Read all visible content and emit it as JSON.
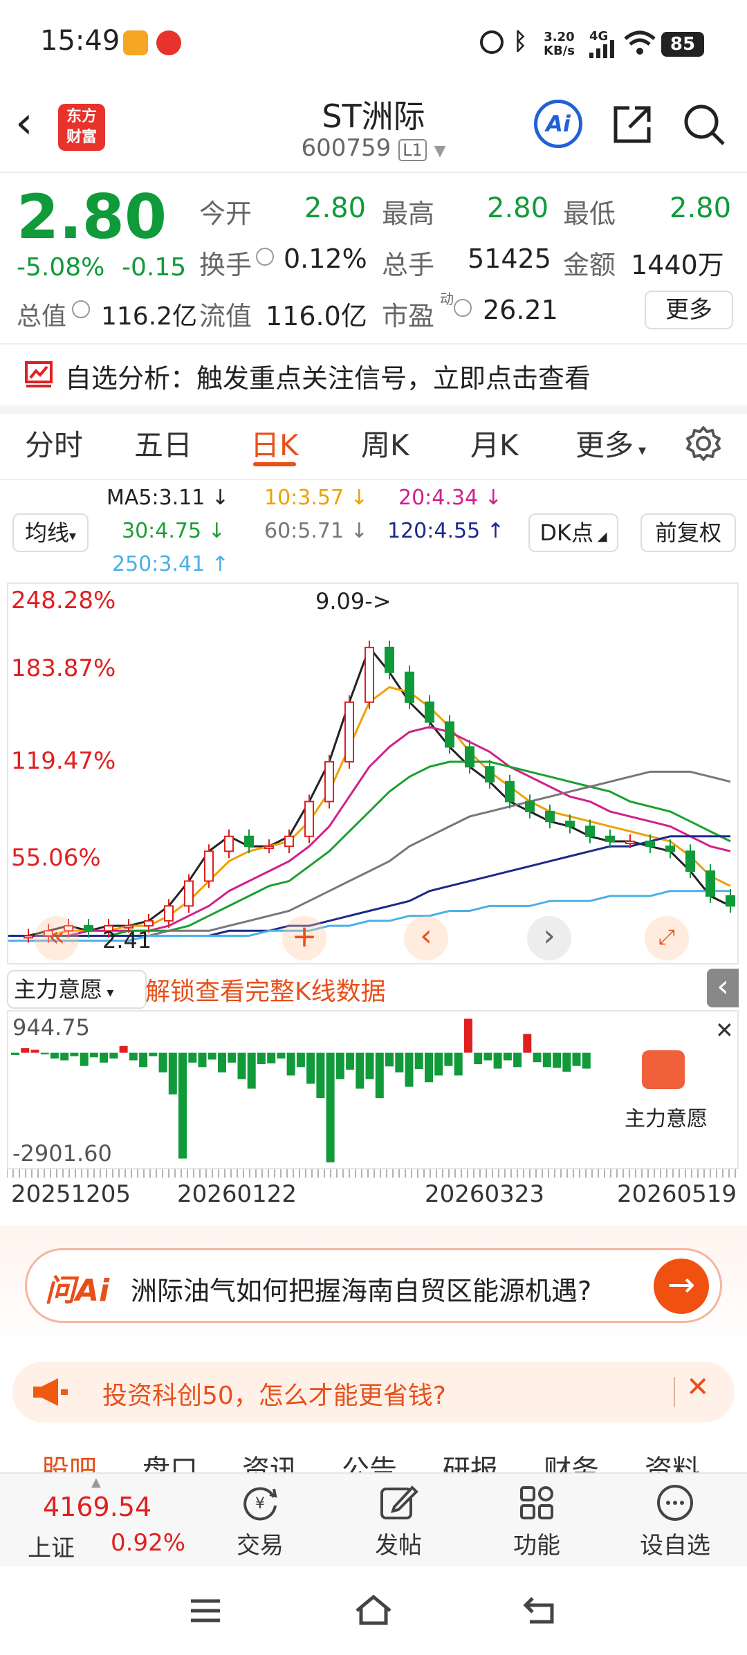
{
  "status_bar": {
    "time": "15:49",
    "net_speed": "3.20",
    "net_unit": "KB/s",
    "signal": "4G",
    "battery": "85"
  },
  "header": {
    "logo_line1": "东方",
    "logo_line2": "财富",
    "title": "ST洲际",
    "code": "600759",
    "market_badge": "L1",
    "ai_label": "Ai"
  },
  "quote": {
    "price": "2.80",
    "change_pct": "-5.08%",
    "change": "-0.15",
    "open_label": "今开",
    "open": "2.80",
    "high_label": "最高",
    "high": "2.80",
    "low_label": "最低",
    "low": "2.80",
    "turnover_label": "换手",
    "turnover": "0.12%",
    "volume_label": "总手",
    "volume": "51425",
    "amount_label": "金额",
    "amount": "1440万",
    "mktcap_label": "总值",
    "mktcap": "116.2亿",
    "float_label": "流值",
    "float": "116.0亿",
    "pe_label": "市盈",
    "pe_sup": "动",
    "pe": "26.21",
    "more": "更多"
  },
  "analysis_banner": {
    "text": "自选分析：触发重点关注信号，立即点击查看"
  },
  "chart_tabs": {
    "t1": "分时",
    "t2": "五日",
    "t3": "日K",
    "t4": "周K",
    "t5": "月K",
    "t6": "更多"
  },
  "indicators": {
    "ma_select": "均线",
    "ma5": "MA5:3.11 ↓",
    "ma10": "10:3.57 ↓",
    "ma20": "20:4.34 ↓",
    "ma30": "30:4.75 ↓",
    "ma60": "60:5.71 ↓",
    "ma120": "120:4.55 ↑",
    "ma250": "250:3.41 ↑",
    "dk": "DK点",
    "adjust": "前复权"
  },
  "colors": {
    "up": "#e02020",
    "down": "#109a3a",
    "ma5": "#222222",
    "ma10": "#f0a000",
    "ma20": "#d0208a",
    "ma30": "#1aa030",
    "ma60": "#777777",
    "ma120": "#1a2a8a",
    "ma250": "#4ab0e8",
    "accent": "#f05a10"
  },
  "chart_data": {
    "type": "candlestick",
    "y_axis_labels": [
      "248.28%",
      "183.87%",
      "119.47%",
      "55.06%"
    ],
    "max_annotation": "9.09->",
    "min_annotation": "2.41",
    "x_axis_labels": [
      "20251205",
      "20260122",
      "20260323",
      "20260519"
    ],
    "ma_series": [
      {
        "name": "MA5",
        "color": "#222222",
        "values": [
          2.5,
          2.5,
          2.6,
          2.7,
          2.6,
          2.7,
          2.7,
          2.8,
          3.1,
          3.6,
          4.2,
          4.5,
          4.3,
          4.3,
          4.5,
          5.2,
          6.0,
          7.2,
          8.3,
          7.8,
          7.2,
          6.8,
          6.3,
          5.9,
          5.6,
          5.2,
          5.0,
          4.8,
          4.7,
          4.5,
          4.4,
          4.4,
          4.3,
          4.2,
          3.8,
          3.3,
          3.1
        ]
      },
      {
        "name": "MA10",
        "color": "#f0a000",
        "values": [
          2.5,
          2.5,
          2.5,
          2.6,
          2.6,
          2.6,
          2.7,
          2.7,
          2.9,
          3.2,
          3.6,
          4.0,
          4.2,
          4.3,
          4.4,
          4.8,
          5.4,
          6.3,
          7.2,
          7.5,
          7.4,
          7.1,
          6.7,
          6.2,
          5.8,
          5.5,
          5.2,
          5.0,
          4.9,
          4.8,
          4.7,
          4.6,
          4.5,
          4.4,
          4.1,
          3.7,
          3.5
        ]
      },
      {
        "name": "MA20",
        "color": "#d0208a",
        "values": [
          2.5,
          2.5,
          2.5,
          2.5,
          2.6,
          2.6,
          2.6,
          2.6,
          2.7,
          2.9,
          3.1,
          3.4,
          3.6,
          3.8,
          4.0,
          4.3,
          4.7,
          5.3,
          5.9,
          6.3,
          6.6,
          6.7,
          6.6,
          6.4,
          6.2,
          5.9,
          5.7,
          5.5,
          5.3,
          5.2,
          5.0,
          4.9,
          4.8,
          4.7,
          4.5,
          4.3,
          4.2
        ]
      },
      {
        "name": "MA30",
        "color": "#1aa030",
        "values": [
          2.5,
          2.5,
          2.5,
          2.5,
          2.5,
          2.5,
          2.6,
          2.6,
          2.6,
          2.7,
          2.9,
          3.1,
          3.3,
          3.5,
          3.6,
          3.9,
          4.2,
          4.6,
          5.0,
          5.4,
          5.7,
          5.9,
          6.0,
          6.0,
          6.0,
          5.9,
          5.8,
          5.7,
          5.6,
          5.5,
          5.4,
          5.2,
          5.1,
          5.0,
          4.8,
          4.6,
          4.4
        ]
      },
      {
        "name": "MA60",
        "color": "#777777",
        "values": [
          2.5,
          2.5,
          2.5,
          2.5,
          2.5,
          2.5,
          2.5,
          2.5,
          2.6,
          2.6,
          2.6,
          2.7,
          2.8,
          2.9,
          3.0,
          3.2,
          3.4,
          3.6,
          3.8,
          4.0,
          4.3,
          4.5,
          4.7,
          4.9,
          5.0,
          5.1,
          5.2,
          5.3,
          5.4,
          5.5,
          5.6,
          5.7,
          5.8,
          5.8,
          5.8,
          5.7,
          5.6
        ]
      },
      {
        "name": "MA120",
        "color": "#1a2a8a",
        "values": [
          2.5,
          2.5,
          2.5,
          2.5,
          2.5,
          2.5,
          2.5,
          2.5,
          2.5,
          2.5,
          2.5,
          2.6,
          2.6,
          2.6,
          2.7,
          2.7,
          2.8,
          2.9,
          3.0,
          3.1,
          3.2,
          3.4,
          3.5,
          3.6,
          3.7,
          3.8,
          3.9,
          4.0,
          4.1,
          4.2,
          4.3,
          4.3,
          4.4,
          4.5,
          4.5,
          4.5,
          4.5
        ]
      },
      {
        "name": "MA250",
        "color": "#4ab0e8",
        "values": [
          2.4,
          2.4,
          2.4,
          2.4,
          2.4,
          2.4,
          2.4,
          2.5,
          2.5,
          2.5,
          2.5,
          2.5,
          2.5,
          2.6,
          2.6,
          2.6,
          2.7,
          2.7,
          2.8,
          2.8,
          2.9,
          2.9,
          3.0,
          3.0,
          3.1,
          3.1,
          3.1,
          3.2,
          3.2,
          3.2,
          3.3,
          3.3,
          3.3,
          3.4,
          3.4,
          3.4,
          3.4
        ]
      }
    ],
    "indicator_panel": {
      "name": "主力意愿",
      "ymax_label": "944.75",
      "ymin_label": "-2901.60",
      "ymax": 944.75,
      "ymin": -2901.6,
      "values": [
        -60,
        120,
        80,
        -40,
        -150,
        -200,
        -90,
        -350,
        -120,
        -260,
        -150,
        180,
        -200,
        -380,
        -90,
        -520,
        -1100,
        -2800,
        -260,
        -380,
        -180,
        -520,
        -260,
        -700,
        -950,
        -300,
        -280,
        -150,
        -600,
        -380,
        -820,
        -1200,
        -2901,
        -700,
        -450,
        -950,
        -700,
        -1200,
        -360,
        -520,
        -900,
        -430,
        -780,
        -600,
        -350,
        -600,
        900,
        -300,
        -200,
        -420,
        -200,
        -380,
        500,
        -250,
        -380,
        -400,
        -500,
        -350,
        -420
      ]
    },
    "indicator_badge": "主力意愿"
  },
  "indicator_bar": {
    "select": "主力意愿",
    "unlock": "解锁查看完整K线数据"
  },
  "ai_banner": {
    "brand": "问Ai",
    "text": "洲际油气如何把握海南自贸区能源机遇?"
  },
  "ad_banner": {
    "text": "投资科创50，怎么才能更省钱?"
  },
  "sub_tabs": {
    "s1": "股吧",
    "s2": "盘口",
    "s3": "资讯",
    "s4": "公告",
    "s5": "研报",
    "s6": "财务",
    "s7": "资料"
  },
  "bottom_nav": {
    "index_value": "4169.54",
    "index_name": "上证",
    "index_change": "0.92%",
    "trade": "交易",
    "post": "发帖",
    "functions": "功能",
    "add_fav": "设自选"
  }
}
